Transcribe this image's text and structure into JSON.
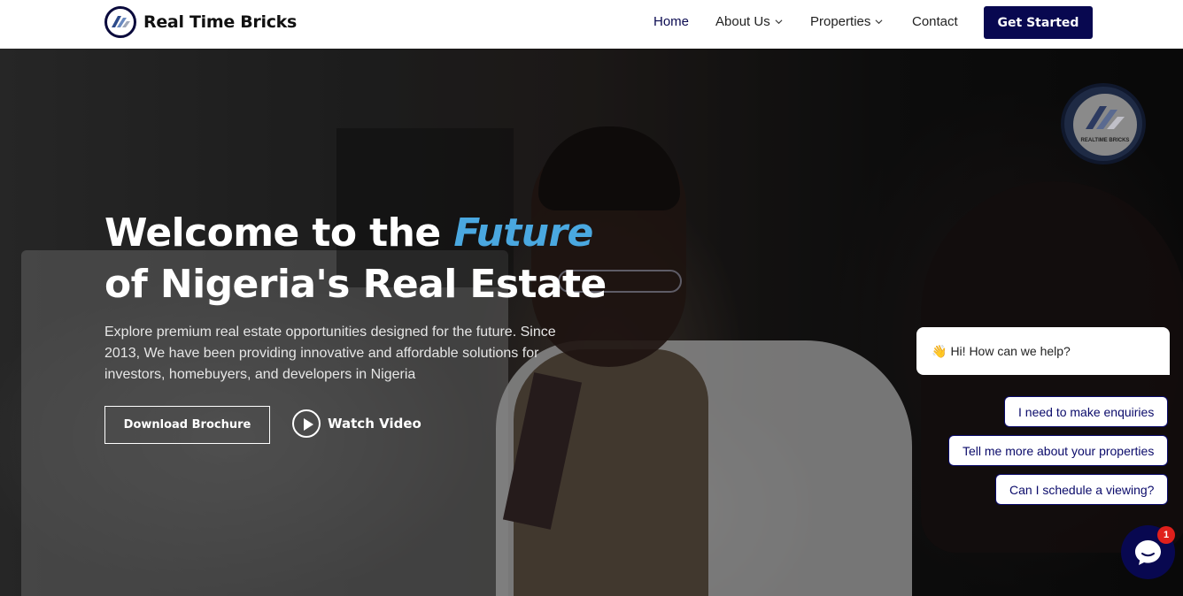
{
  "header": {
    "brand": "Real Time Bricks",
    "nav": [
      {
        "label": "Home",
        "active": true
      },
      {
        "label": "About Us",
        "dropdown": true
      },
      {
        "label": "Properties",
        "dropdown": true
      },
      {
        "label": "Contact"
      }
    ],
    "cta": "Get Started"
  },
  "hero": {
    "title_line1_prefix": "Welcome to the ",
    "title_line1_accent": "Future",
    "title_line2": "of Nigeria's Real Estate",
    "description": "Explore premium real estate opportunities designed for the future. Since 2013, We have been providing innovative and affordable solutions for investors, homebuyers, and developers in Nigeria",
    "brochure_button": "Download Brochure",
    "video_button": "Watch Video"
  },
  "floating_logo": {
    "text": "REALTIME BRICKS"
  },
  "chat": {
    "greeting_emoji": "👋",
    "greeting": "Hi! How can we help?",
    "quick_replies": [
      "I need to make enquiries",
      "Tell me more about your properties",
      "Can I schedule a viewing?"
    ],
    "badge_count": "1"
  },
  "colors": {
    "primary": "#080850",
    "accent": "#4aa8e0",
    "badge": "#e0201c"
  }
}
